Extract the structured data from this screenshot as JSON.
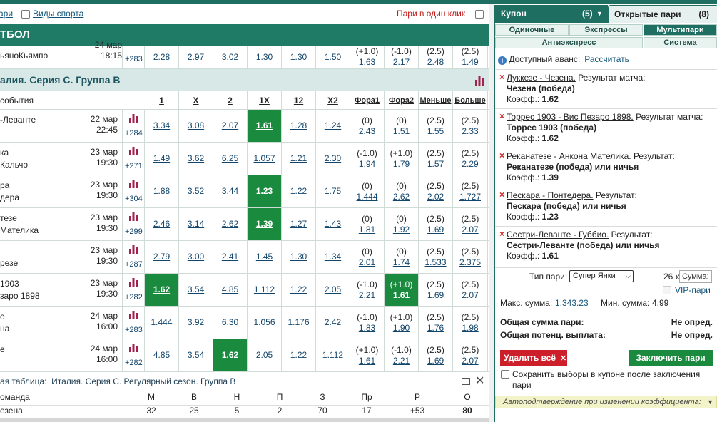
{
  "filters": {
    "link1": "ари",
    "link2": "Виды спорта",
    "one_click": "Пари в один клик"
  },
  "sport_header": "ТБОЛ",
  "prev_event": {
    "team": "ьяноКьямпо",
    "date": "24 мар",
    "time": "18:15",
    "plus": "+283",
    "odds": [
      "2.28",
      "2.97",
      "3.02",
      "1.30",
      "1.30",
      "1.50"
    ],
    "f1": [
      "(+1.0)",
      "1.63"
    ],
    "f2": [
      "(-1.0)",
      "2.17"
    ],
    "u": [
      "(2.5)",
      "2.48"
    ],
    "o": [
      "(2.5)",
      "1.49"
    ]
  },
  "championship": "алия. Серия С. Группа B",
  "columns": {
    "event": "события",
    "c1": "1",
    "cx": "X",
    "c2": "2",
    "c1x": "1X",
    "c12": "12",
    "cx2": "X2",
    "f1": "Фора1",
    "f2": "Фора2",
    "under": "Меньше",
    "over": "Больше"
  },
  "events": [
    {
      "t1": "-Леванте",
      "t2": "",
      "date": "22 мар",
      "time": "22:45",
      "plus": "+284",
      "o1": "3.34",
      "ox": "3.08",
      "o2": "2.07",
      "o1x": "1.61",
      "o12": "1.28",
      "ox2": "1.24",
      "f1h": "(0)",
      "f1": "2.43",
      "f2h": "(0)",
      "f2": "1.51",
      "uh": "(2.5)",
      "u": "1.55",
      "oh": "(2.5)",
      "ov": "2.33",
      "hl": "1x"
    },
    {
      "t1": "ка",
      "t2": "Кальчо",
      "date": "23 мар",
      "time": "19:30",
      "plus": "+271",
      "o1": "1.49",
      "ox": "3.62",
      "o2": "6.25",
      "o1x": "1.057",
      "o12": "1.21",
      "ox2": "2.30",
      "f1h": "(-1.0)",
      "f1": "1.94",
      "f2h": "(+1.0)",
      "f2": "1.79",
      "uh": "(2.5)",
      "u": "1.57",
      "oh": "(2.5)",
      "ov": "2.29",
      "hl": ""
    },
    {
      "t1": "ра",
      "t2": "дера",
      "date": "23 мар",
      "time": "19:30",
      "plus": "+304",
      "o1": "1.88",
      "ox": "3.52",
      "o2": "3.44",
      "o1x": "1.23",
      "o12": "1.22",
      "ox2": "1.75",
      "f1h": "(0)",
      "f1": "1.444",
      "f2h": "(0)",
      "f2": "2.62",
      "uh": "(2.5)",
      "u": "2.02",
      "oh": "(2.5)",
      "ov": "1.727",
      "hl": "1x"
    },
    {
      "t1": "тезе",
      "t2": "Мателика",
      "date": "23 мар",
      "time": "19:30",
      "plus": "+299",
      "o1": "2.46",
      "ox": "3.14",
      "o2": "2.62",
      "o1x": "1.39",
      "o12": "1.27",
      "ox2": "1.43",
      "f1h": "(0)",
      "f1": "1.81",
      "f2h": "(0)",
      "f2": "1.92",
      "uh": "(2.5)",
      "u": "1.69",
      "oh": "(2.5)",
      "ov": "2.07",
      "hl": "1x"
    },
    {
      "t1": "",
      "t2": "резе",
      "date": "23 мар",
      "time": "19:30",
      "plus": "+287",
      "o1": "2.79",
      "ox": "3.00",
      "o2": "2.41",
      "o1x": "1.45",
      "o12": "1.30",
      "ox2": "1.34",
      "f1h": "(0)",
      "f1": "2.01",
      "f2h": "(0)",
      "f2": "1.74",
      "uh": "(2.5)",
      "u": "1.533",
      "oh": "(2.5)",
      "ov": "2.375",
      "hl": ""
    },
    {
      "t1": "1903",
      "t2": "заро 1898",
      "date": "23 мар",
      "time": "19:30",
      "plus": "+282",
      "o1": "1.62",
      "ox": "3.54",
      "o2": "4.85",
      "o1x": "1.112",
      "o12": "1.22",
      "ox2": "2.05",
      "f1h": "(-1.0)",
      "f1": "2.21",
      "f2h": "(+1.0)",
      "f2": "1.61",
      "uh": "(2.5)",
      "u": "1.69",
      "oh": "(2.5)",
      "ov": "2.07",
      "hl": "1,f2"
    },
    {
      "t1": "о",
      "t2": "на",
      "date": "24 мар",
      "time": "16:00",
      "plus": "+283",
      "o1": "1.444",
      "ox": "3.92",
      "o2": "6.30",
      "o1x": "1.056",
      "o12": "1.176",
      "ox2": "2.42",
      "f1h": "(-1.0)",
      "f1": "1.83",
      "f2h": "(+1.0)",
      "f2": "1.90",
      "uh": "(2.5)",
      "u": "1.76",
      "oh": "(2.5)",
      "ov": "1.98",
      "hl": ""
    },
    {
      "t1": "е",
      "t2": "",
      "date": "24 мар",
      "time": "16:00",
      "plus": "+282",
      "o1": "4.85",
      "ox": "3.54",
      "o2": "1.62",
      "o1x": "2.05",
      "o12": "1.22",
      "ox2": "1.112",
      "f1h": "(+1.0)",
      "f1": "1.61",
      "f2h": "(-1.0)",
      "f2": "2.21",
      "uh": "(2.5)",
      "u": "1.69",
      "oh": "(2.5)",
      "ov": "2.07",
      "hl": "2"
    }
  ],
  "standings": {
    "prefix": "ая таблица:",
    "title": "Италия. Серия С. Регулярный сезон. Группа B",
    "headers": [
      "оманда",
      "М",
      "В",
      "Н",
      "П",
      "З",
      "Пр",
      "Р",
      "О"
    ],
    "row": [
      "езена",
      "32",
      "25",
      "5",
      "2",
      "70",
      "17",
      "+53",
      "80"
    ]
  },
  "coupon": {
    "tab1": "Купон",
    "tab1_count": "(5)",
    "tab2": "Открытые пари",
    "tab2_count": "(8)",
    "types": [
      "Одиночные",
      "Экспрессы",
      "Мультипари",
      "Антиэкспресс",
      "Система"
    ],
    "advance_label": "Доступный аванс:",
    "advance_link": "Рассчитать",
    "bets": [
      {
        "event": "Луккезе - Чезена.",
        "market": "Результат матча:",
        "selection": "Чезена (победа)",
        "coef_label": "Коэфф.:",
        "coef": "1.62"
      },
      {
        "event": "Торрес 1903 - Вис Пезаро 1898.",
        "market": "Результат матча:",
        "selection": "Торрес 1903 (победа)",
        "coef_label": "Коэфф.:",
        "coef": "1.62"
      },
      {
        "event": "Реканатезе - Анкона Мателика.",
        "market": "Результат:",
        "selection": "Реканатезе (победа) или ничья",
        "coef_label": "Коэфф.:",
        "coef": "1.39"
      },
      {
        "event": "Пескара - Понтедера.",
        "market": "Результат:",
        "selection": "Пескара (победа) или ничья",
        "coef_label": "Коэфф.:",
        "coef": "1.23"
      },
      {
        "event": "Сестри-Леванте - Губбио.",
        "market": "Результат:",
        "selection": "Сестри-Леванте (победа) или ничья",
        "coef_label": "Коэфф.:",
        "coef": "1.61"
      }
    ],
    "type_label": "Тип пари:",
    "type_value": "Супер Янки",
    "multiplier": "26 x",
    "sum_placeholder": "Сумма:",
    "vip": "VIP-пари",
    "max_label": "Макс. сумма:",
    "max_value": "1,343.23",
    "min_label": "Мин. сумма:",
    "min_value": "4.99",
    "total_label": "Общая сумма пари:",
    "total_value": "Не опред.",
    "payout_label": "Общая потенц. выплата:",
    "payout_value": "Не опред.",
    "delete": "Удалить всё",
    "conclude": "Заключить пари",
    "save": "Сохранить выборы в купоне после заключения пари",
    "auto": "Автоподтверждение при изменении коэффициента:"
  }
}
